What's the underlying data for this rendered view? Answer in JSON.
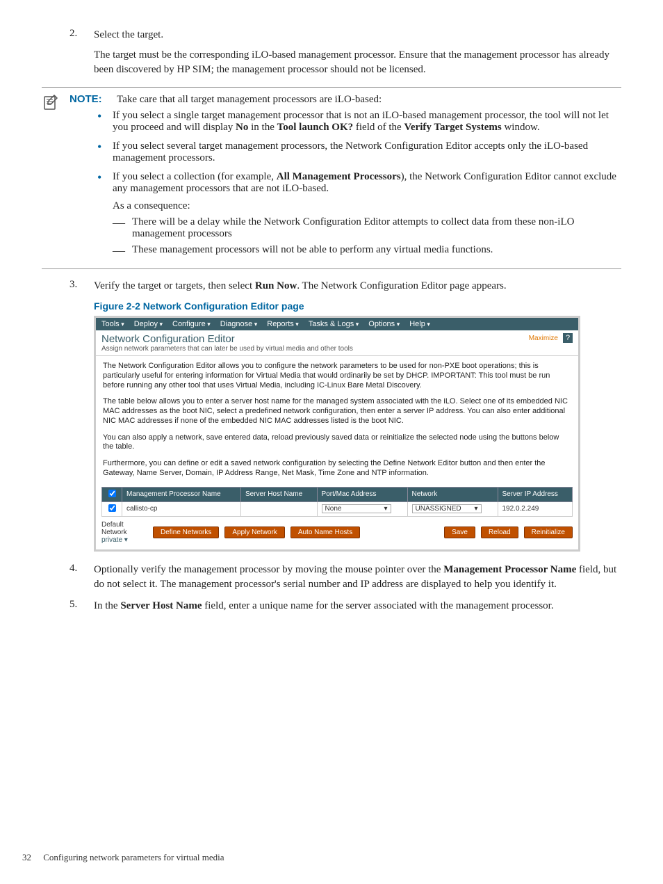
{
  "steps": {
    "s2": {
      "num": "2.",
      "title": "Select the target.",
      "para": "The target must be the corresponding iLO-based management processor. Ensure that the management processor has already been discovered by HP SIM; the management processor should not be licensed."
    },
    "s3": {
      "num": "3.",
      "text_a": "Verify the target or targets, then select ",
      "bold": "Run Now",
      "text_b": ". The Network Configuration Editor page appears."
    },
    "s4": {
      "num": "4.",
      "text_a": "Optionally verify the management processor by moving the mouse pointer over the ",
      "bold": "Management Processor Name",
      "text_b": " field, but do not select it. The management processor's serial number and IP address are displayed to help you identify it."
    },
    "s5": {
      "num": "5.",
      "text_a": "In the ",
      "bold": "Server Host Name",
      "text_b": " field, enter a unique name for the server associated with the management processor."
    }
  },
  "note": {
    "label": "NOTE:",
    "lead": "Take care that all target management processors are iLO-based:",
    "b1_a": "If you select a single target management processor that is not an iLO-based management processor, the tool will not let you proceed and will display ",
    "b1_bold1": "No",
    "b1_mid": " in the ",
    "b1_bold2": "Tool launch OK?",
    "b1_b": " field of the ",
    "b1_bold3": "Verify Target Systems",
    "b1_c": " window.",
    "b2": "If you select several target management processors, the Network Configuration Editor accepts only the iLO-based management processors.",
    "b3_a": "If you select a collection (for example, ",
    "b3_bold": "All Management Processors",
    "b3_b": "), the Network Configuration Editor cannot exclude any management processors that are not iLO-based.",
    "b3_cons": "As a consequence:",
    "b3_d1": "There will be a delay while the Network Configuration Editor attempts to collect data from these non-iLO management processors",
    "b3_d2": "These management processors will not be able to perform any virtual media functions."
  },
  "figure": {
    "caption": "Figure 2-2 Network Configuration Editor page"
  },
  "screenshot": {
    "menu": [
      "Tools",
      "Deploy",
      "Configure",
      "Diagnose",
      "Reports",
      "Tasks & Logs",
      "Options",
      "Help"
    ],
    "title": "Network Configuration Editor",
    "subtitle": "Assign network parameters that can later be used by virtual media and other tools",
    "maximize": "Maximize",
    "para1": "The Network Configuration Editor allows you to configure the network parameters to be used for non-PXE boot operations; this is particularly useful for entering information for Virtual Media that would ordinarily be set by DHCP. IMPORTANT: This tool must be run before running any other tool that uses Virtual Media, including IC-Linux Bare Metal Discovery.",
    "para2": "The table below allows you to enter a server host name for the managed system associated with the iLO. Select one of its embedded NIC MAC addresses as the boot NIC, select a predefined network configuration, then enter a server IP address. You can also enter additional NIC MAC addresses if none of the embedded NIC MAC addresses listed is the boot NIC.",
    "para3": "You can also apply a network, save entered data, reload previously saved data or reinitialize the selected node using the buttons below the table.",
    "para4": "Furthermore, you can define or edit a saved network configuration by selecting the Define Network Editor button and then enter the Gateway, Name Server, Domain, IP Address Range, Net Mask, Time Zone and NTP information.",
    "headers": [
      "Management Processor Name",
      "Server Host Name",
      "Port/Mac Address",
      "Network",
      "Server IP Address"
    ],
    "row": {
      "name": "callisto-cp",
      "host": "",
      "port": "None",
      "network": "UNASSIGNED",
      "ip": "192.0.2.249"
    },
    "default_label": "Default Network",
    "default_value": "private",
    "buttons": [
      "Define Networks",
      "Apply Network",
      "Auto Name Hosts",
      "Save",
      "Reload",
      "Reinitialize"
    ]
  },
  "footer": {
    "page": "32",
    "title": "Configuring network parameters for virtual media"
  }
}
